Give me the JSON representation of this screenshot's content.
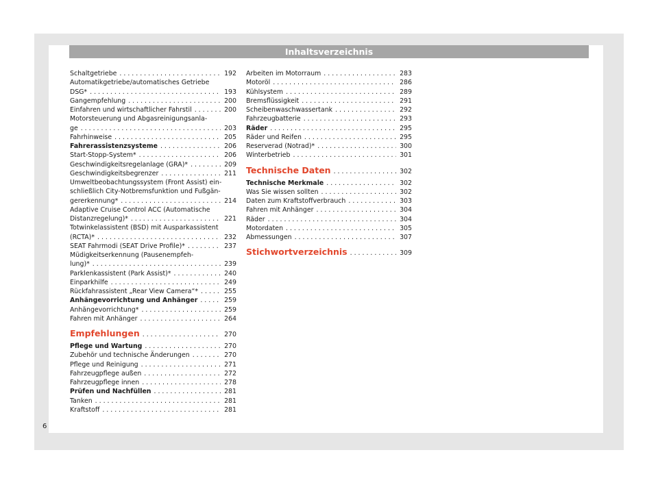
{
  "header": {
    "title": "Inhaltsverzeichnis"
  },
  "left_column": [
    {
      "label": "Schaltgetriebe",
      "page": "192"
    },
    {
      "label": "Automatikgetriebe/automatisches Getriebe",
      "page": ""
    },
    {
      "label": "DSG*",
      "page": "193"
    },
    {
      "label": "Gangempfehlung",
      "page": "200"
    },
    {
      "label": "Einfahren und wirtschaftlicher Fahrstil",
      "page": "200"
    },
    {
      "label": "Motorsteuerung und Abgasreinigungsanla-",
      "page": ""
    },
    {
      "label": "ge",
      "page": "203"
    },
    {
      "label": "Fahrhinweise",
      "page": "205"
    },
    {
      "label": "Fahrerassistenzsysteme",
      "page": "206",
      "style": "bold"
    },
    {
      "label": "Start-Stopp-System*",
      "page": "206"
    },
    {
      "label": "Geschwindigkeitsregelanlage (GRA)*",
      "page": "209"
    },
    {
      "label": "Geschwindigkeitsbegrenzer",
      "page": "211"
    },
    {
      "label": "Umweltbeobachtungssystem (Front Assist) ein-",
      "page": ""
    },
    {
      "label": "schließlich City-Notbremsfunktion und Fußgän-",
      "page": ""
    },
    {
      "label": "gererkennung*",
      "page": "214"
    },
    {
      "label": "Adaptive Cruise Control ACC (Automatische",
      "page": ""
    },
    {
      "label": "Distanzregelung)*",
      "page": "221"
    },
    {
      "label": "Totwinkelassistent (BSD) mit Ausparkassistent",
      "page": ""
    },
    {
      "label": "(RCTA)*",
      "page": "232"
    },
    {
      "label": "SEAT Fahrmodi (SEAT Drive Profile)*",
      "page": "237"
    },
    {
      "label": "Müdigkeitserkennung (Pausenempfeh-",
      "page": ""
    },
    {
      "label": "lung)*",
      "page": "239"
    },
    {
      "label": "Parklenkassistent (Park Assist)*",
      "page": "240"
    },
    {
      "label": "Einparkhilfe",
      "page": "249"
    },
    {
      "label": "Rückfahrassistent „Rear View Camera“*",
      "page": "255"
    },
    {
      "label": "Anhängevorrichtung und Anhänger",
      "page": "259",
      "style": "bold"
    },
    {
      "label": "Anhängevorrichtung*",
      "page": "259"
    },
    {
      "label": "Fahren mit Anhänger",
      "page": "264"
    },
    {
      "label": "Empfehlungen",
      "page": "270",
      "style": "section"
    },
    {
      "label": "Pflege und Wartung",
      "page": "270",
      "style": "bold"
    },
    {
      "label": "Zubehör und technische Änderungen",
      "page": "270"
    },
    {
      "label": "Pflege und Reinigung",
      "page": "271"
    },
    {
      "label": "Fahrzeugpflege außen",
      "page": "272"
    },
    {
      "label": "Fahrzeugpflege innen",
      "page": "278"
    },
    {
      "label": "Prüfen und Nachfüllen",
      "page": "281",
      "style": "bold"
    },
    {
      "label": "Tanken",
      "page": "281"
    },
    {
      "label": "Kraftstoff",
      "page": "281"
    }
  ],
  "right_column": [
    {
      "label": "Arbeiten im Motorraum",
      "page": "283"
    },
    {
      "label": "Motoröl",
      "page": "286"
    },
    {
      "label": "Kühlsystem",
      "page": "289"
    },
    {
      "label": "Bremsflüssigkeit",
      "page": "291"
    },
    {
      "label": "Scheibenwaschwassertank",
      "page": "292"
    },
    {
      "label": "Fahrzeugbatterie",
      "page": "293"
    },
    {
      "label": "Räder",
      "page": "295",
      "style": "bold"
    },
    {
      "label": "Räder und Reifen",
      "page": "295"
    },
    {
      "label": "Reserverad (Notrad)*",
      "page": "300"
    },
    {
      "label": "Winterbetrieb",
      "page": "301"
    },
    {
      "label": "Technische Daten",
      "page": "302",
      "style": "section"
    },
    {
      "label": "Technische Merkmale",
      "page": "302",
      "style": "bold"
    },
    {
      "label": "Was Sie wissen sollten",
      "page": "302"
    },
    {
      "label": "Daten zum Kraftstoffverbrauch",
      "page": "303"
    },
    {
      "label": "Fahren mit Anhänger",
      "page": "304"
    },
    {
      "label": "Räder",
      "page": "304"
    },
    {
      "label": "Motordaten",
      "page": "305"
    },
    {
      "label": "Abmessungen",
      "page": "307"
    },
    {
      "label": "Stichwortverzeichnis",
      "page": "309",
      "style": "section"
    }
  ],
  "footer": {
    "page_number": "6"
  },
  "colors": {
    "header_bar": "#a6a6a6",
    "section_heading": "#e2462c",
    "background": "#e6e6e6"
  }
}
